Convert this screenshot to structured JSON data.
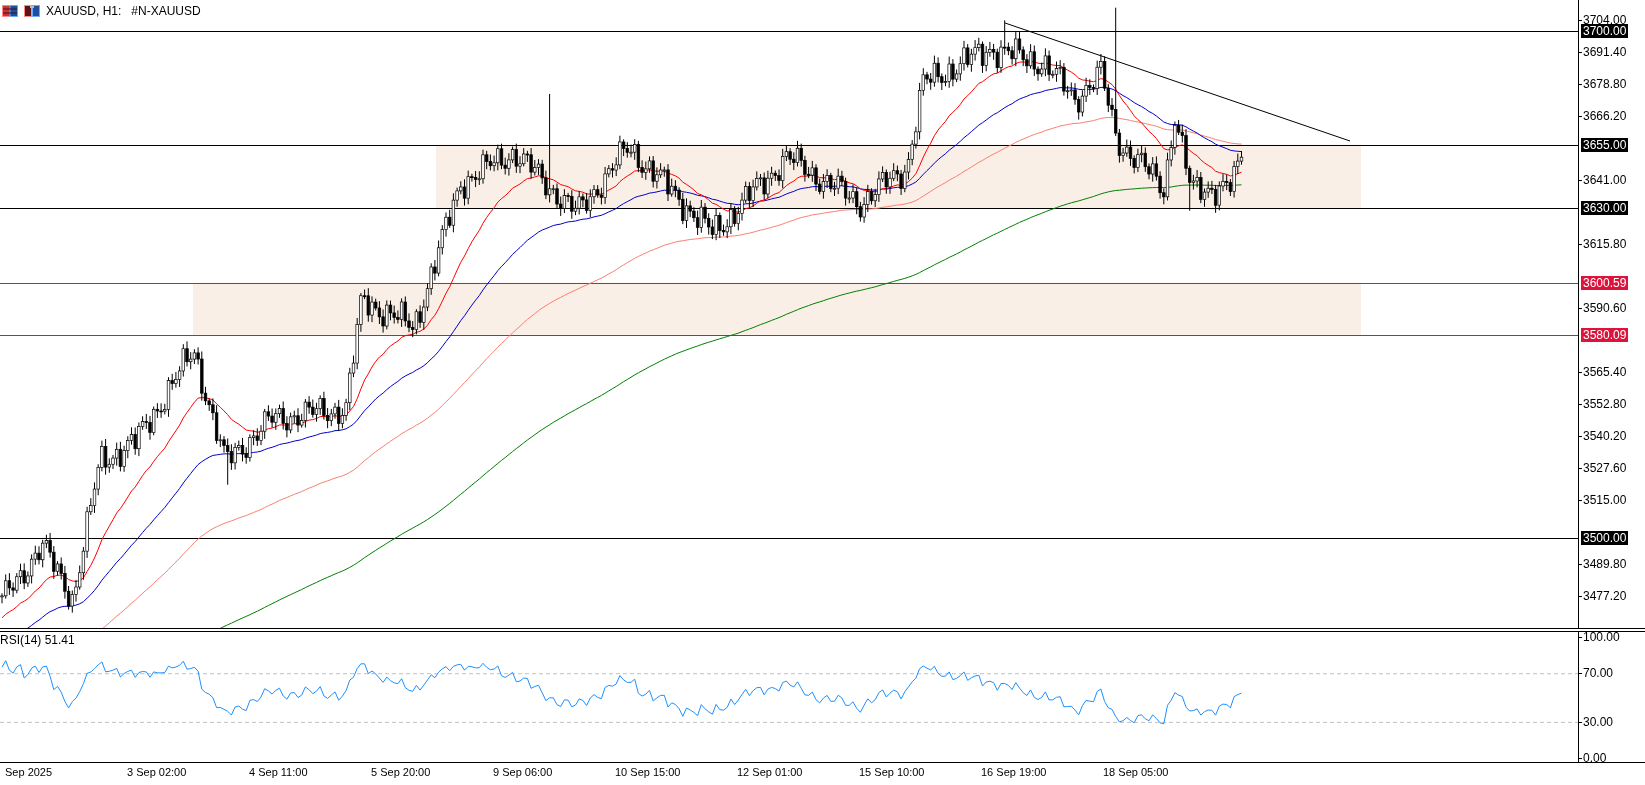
{
  "window": {
    "symbol": "XAUUSD, H1:",
    "description": "#N-XAUUSD"
  },
  "price_axis": {
    "ticks": [
      "3704.00",
      "3691.40",
      "3678.80",
      "3666.20",
      "3641.00",
      "3615.80",
      "3590.60",
      "3565.40",
      "3552.80",
      "3540.20",
      "3527.60",
      "3515.00",
      "3489.80",
      "3477.20"
    ],
    "levels": [
      {
        "label": "3700.00",
        "color": "#000000"
      },
      {
        "label": "3655.00",
        "color": "#000000"
      },
      {
        "label": "3630.00",
        "color": "#000000"
      },
      {
        "label": "3600.59",
        "color": "#dc143c"
      },
      {
        "label": "3580.09",
        "color": "#dc143c"
      },
      {
        "label": "3500.00",
        "color": "#000000"
      }
    ]
  },
  "rsi": {
    "title": "RSI(14) 51.41",
    "ticks": [
      "100.00",
      "70.00",
      "30.00",
      "0.00"
    ]
  },
  "time_axis": {
    "labels": [
      "Sep 2025",
      "3 Sep 02:00",
      "4 Sep 11:00",
      "5 Sep 20:00",
      "9 Sep 06:00",
      "10 Sep 15:00",
      "12 Sep 01:00",
      "15 Sep 10:00",
      "16 Sep 19:00",
      "18 Sep 05:00"
    ]
  }
}
